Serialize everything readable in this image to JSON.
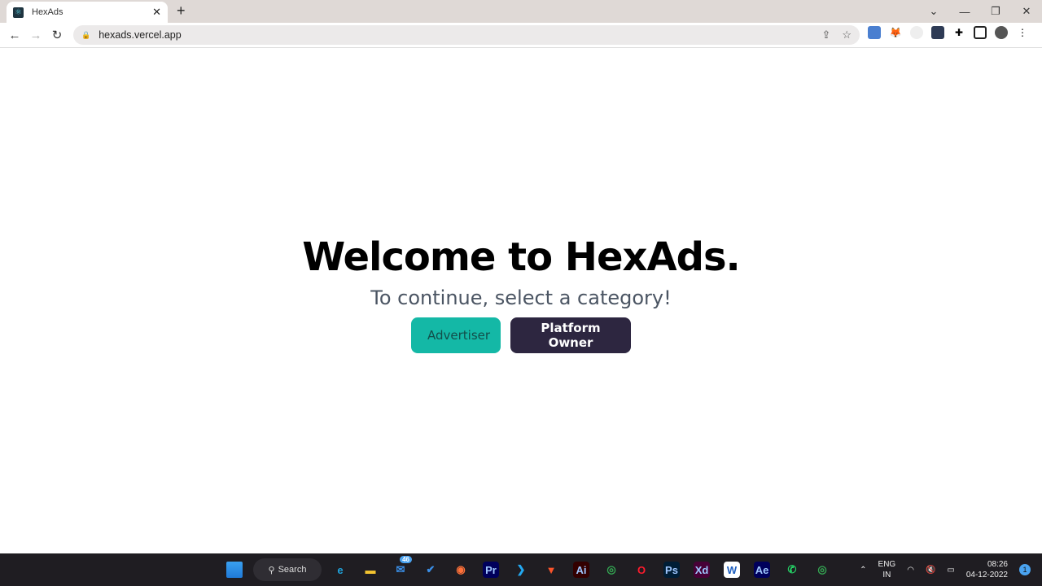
{
  "browser": {
    "tab_title": "HexAds",
    "url": "hexads.vercel.app"
  },
  "page": {
    "title": "Welcome to HexAds.",
    "subtitle": "To continue, select a category!",
    "buttons": {
      "advertiser": "Advertiser",
      "platform_owner": "Platform Owner"
    },
    "colors": {
      "advertiser_bg": "#14b8a6",
      "platform_owner_bg": "#2d2640"
    }
  },
  "taskbar": {
    "search_label": "Search",
    "mail_badge": "46",
    "apps": [
      {
        "name": "edge",
        "label": "e",
        "color": "#1fa0d8"
      },
      {
        "name": "file-explorer",
        "label": "▬",
        "color": "#f4c430"
      },
      {
        "name": "mail",
        "label": "✉",
        "color": "#3a8ee6"
      },
      {
        "name": "todo",
        "label": "✔",
        "color": "#3a8ee6"
      },
      {
        "name": "firefox",
        "label": "◉",
        "color": "#ff7139"
      },
      {
        "name": "premiere",
        "label": "Pr",
        "color": "#00005b"
      },
      {
        "name": "vscode",
        "label": "❯",
        "color": "#23a9f2"
      },
      {
        "name": "brave",
        "label": "▼",
        "color": "#fb542b"
      },
      {
        "name": "illustrator",
        "label": "Ai",
        "color": "#330000"
      },
      {
        "name": "chrome",
        "label": "◎",
        "color": "#34a853"
      },
      {
        "name": "opera",
        "label": "O",
        "color": "#ff1b2d"
      },
      {
        "name": "photoshop",
        "label": "Ps",
        "color": "#001e36"
      },
      {
        "name": "xd",
        "label": "Xd",
        "color": "#470137"
      },
      {
        "name": "app-w",
        "label": "W",
        "color": "#ffffff"
      },
      {
        "name": "after-effects",
        "label": "Ae",
        "color": "#00005b"
      },
      {
        "name": "whatsapp",
        "label": "✆",
        "color": "#25d366"
      },
      {
        "name": "chrome-profile",
        "label": "◎",
        "color": "#34a853"
      }
    ],
    "language": "ENG",
    "region": "IN",
    "time": "08:26",
    "date": "04-12-2022",
    "notifications": "1"
  }
}
